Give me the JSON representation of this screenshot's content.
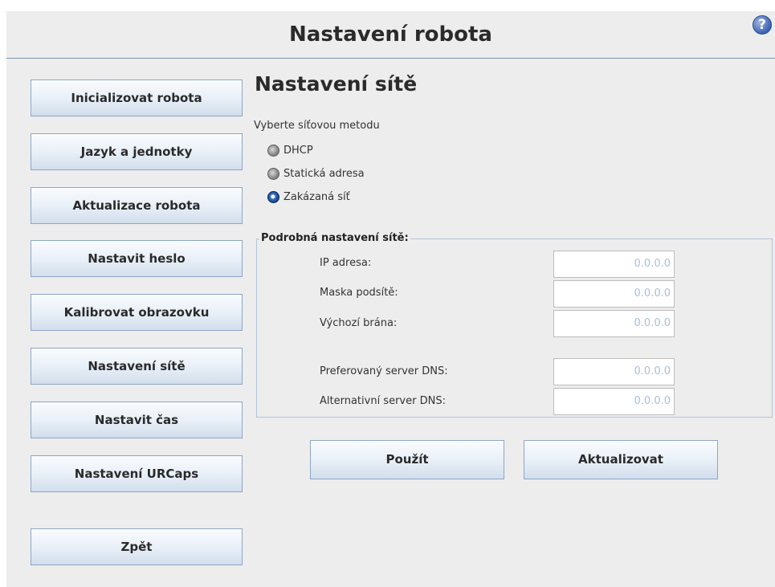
{
  "header": {
    "title": "Nastavení robota",
    "help_icon": "question-circle-icon",
    "help_glyph": "?"
  },
  "sidebar": {
    "items": [
      {
        "label": "Inicializovat robota"
      },
      {
        "label": "Jazyk a jednotky"
      },
      {
        "label": "Aktualizace robota"
      },
      {
        "label": "Nastavit heslo"
      },
      {
        "label": "Kalibrovat obrazovku"
      },
      {
        "label": "Nastavení sítě"
      },
      {
        "label": "Nastavit čas"
      },
      {
        "label": "Nastavení URCaps"
      },
      {
        "label": "Zpět"
      }
    ]
  },
  "main": {
    "title": "Nastavení sítě",
    "method_label": "Vyberte síťovou metodu",
    "methods": [
      {
        "label": "DHCP",
        "selected": false
      },
      {
        "label": "Statická adresa",
        "selected": false
      },
      {
        "label": "Zakázaná síť",
        "selected": true
      }
    ],
    "details": {
      "legend": "Podrobná nastavení sítě:",
      "fields": [
        {
          "label": "IP adresa:",
          "value": "0.0.0.0"
        },
        {
          "label": "Maska podsítě:",
          "value": "0.0.0.0"
        },
        {
          "label": "Výchozí brána:",
          "value": "0.0.0.0"
        },
        {
          "label": "Preferovaný server DNS:",
          "value": "0.0.0.0"
        },
        {
          "label": "Alternativní server DNS:",
          "value": "0.0.0.0"
        }
      ]
    },
    "apply_label": "Použít",
    "refresh_label": "Aktualizovat"
  },
  "colors": {
    "background": "#ededed",
    "button_border": "#8da6c6",
    "accent": "#7d95b5",
    "input_text": "#a8bfdc"
  }
}
